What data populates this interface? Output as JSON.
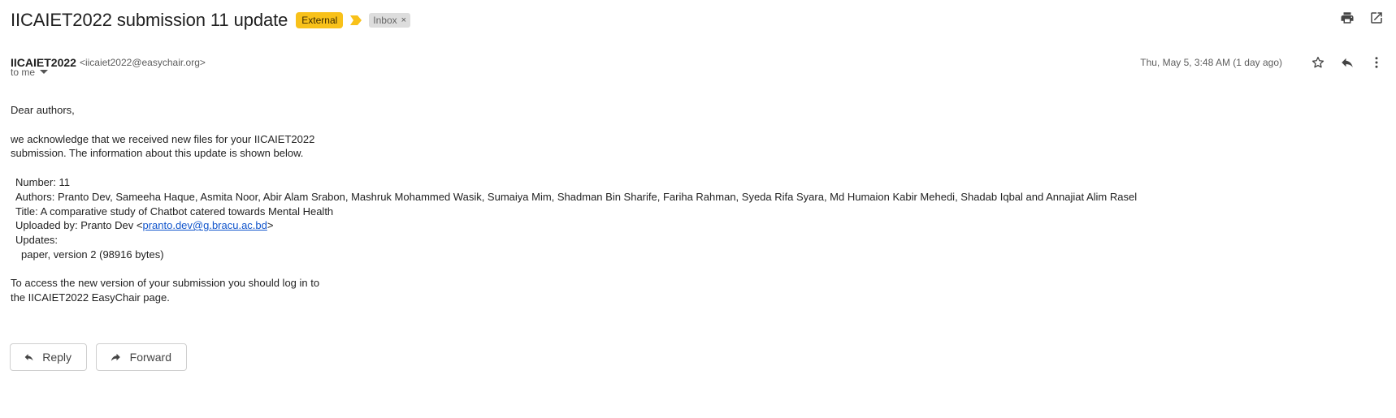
{
  "header": {
    "subject": "IICAIET2022 submission 11 update",
    "external_label": "External",
    "inbox_label": "Inbox",
    "inbox_remove": "×"
  },
  "sender": {
    "name": "IICAIET2022",
    "email": "<iicaiet2022@easychair.org>",
    "date": "Thu, May 5, 3:48 AM (1 day ago)",
    "to": "to me"
  },
  "message": {
    "greeting": "Dear authors,",
    "ack_line1": "we acknowledge that we received new files for your IICAIET2022",
    "ack_line2": "submission. The information about this update is shown below.",
    "number": "Number: 11",
    "authors": "Authors: Pranto Dev, Sameeha Haque, Asmita Noor, Abir Alam Srabon, Mashruk Mohammed Wasik, Sumaiya Mim, Shadman Bin Sharife, Fariha Rahman, Syeda Rifa Syara, Md Humaion Kabir Mehedi, Shadab Iqbal and Annajiat Alim Rasel",
    "title": "Title: A comparative study of Chatbot catered towards Mental Health",
    "uploaded_prefix": "Uploaded by: Pranto Dev <",
    "uploaded_email": "pranto.dev@g.bracu.ac.bd",
    "uploaded_suffix": ">",
    "updates": "Updates:",
    "update_item": "paper, version 2 (98916 bytes)",
    "access_line1": "To access the new version of your submission you should log in to",
    "access_line2": "the IICAIET2022 EasyChair page."
  },
  "actions": {
    "reply_label": "Reply",
    "forward_label": "Forward"
  },
  "icons": {
    "print": "print-icon",
    "open_new": "open-in-new-window-icon",
    "star": "star-icon",
    "reply": "reply-icon",
    "more": "more-vert-icon",
    "importance": "importance-marker-icon",
    "dropdown": "caret-down-icon",
    "forward": "forward-icon"
  },
  "colors": {
    "external_badge": "#f8c11a",
    "importance_marker": "#f8c11a",
    "inbox_badge": "#dddddd",
    "link": "#1155cc"
  }
}
